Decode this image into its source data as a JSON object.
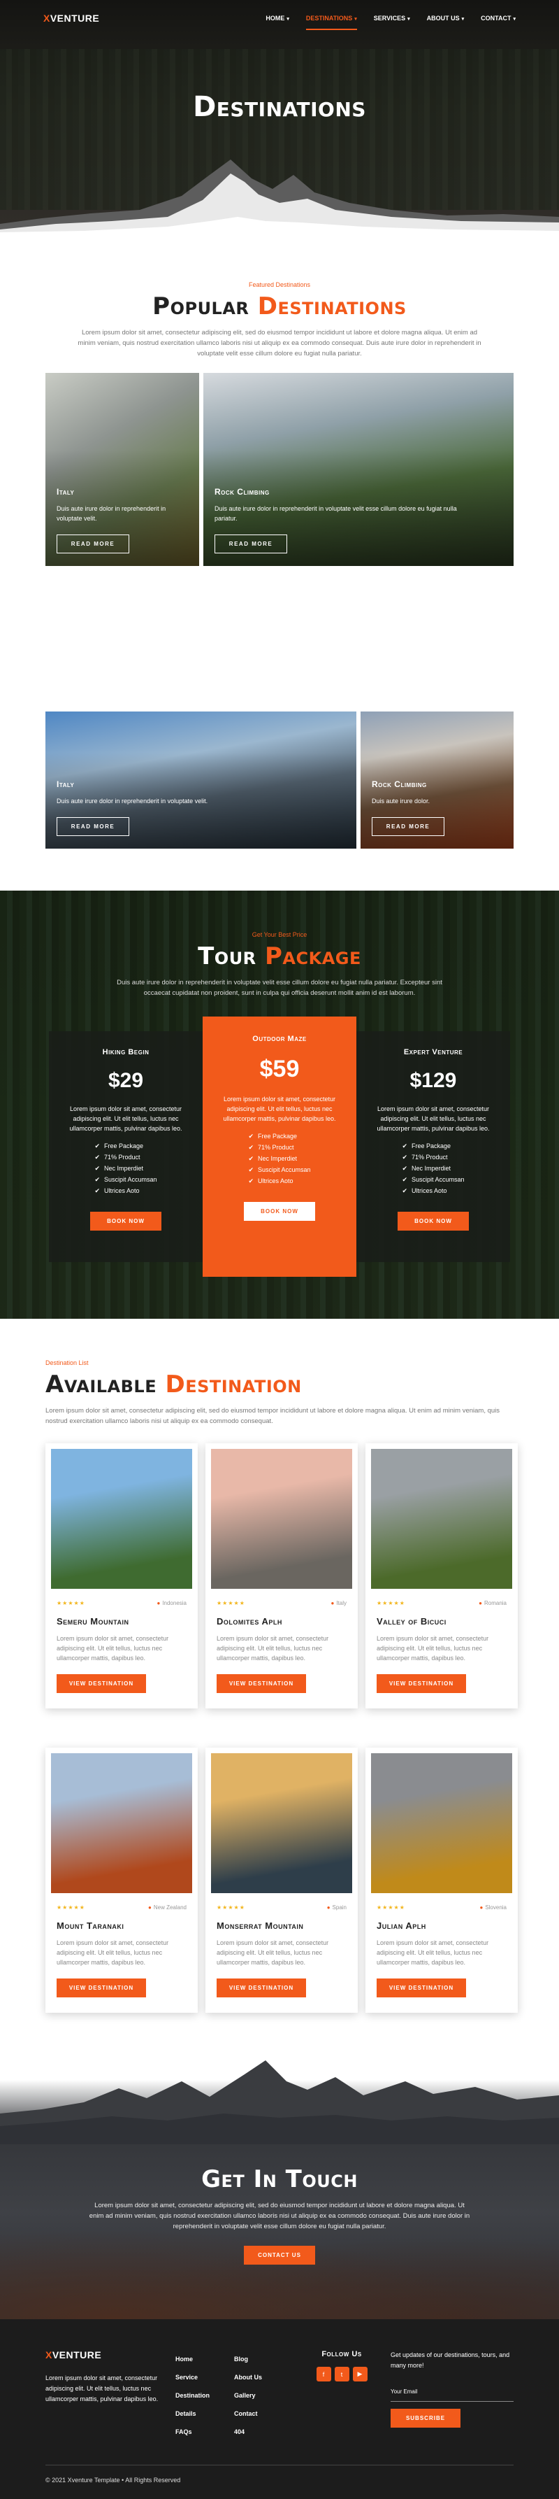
{
  "nav": {
    "logo_x": "X",
    "logo_rest": "VENTURE",
    "items": [
      {
        "label": "Home",
        "caret": "▾",
        "active": false
      },
      {
        "label": "Destinations",
        "caret": "▾",
        "active": true
      },
      {
        "label": "Services",
        "caret": "▾",
        "active": false
      },
      {
        "label": "About Us",
        "caret": "▾",
        "active": false
      },
      {
        "label": "Contact",
        "caret": "▾",
        "active": false
      }
    ]
  },
  "hero": {
    "title": "Destinations"
  },
  "popular": {
    "kicker": "Featured Destinations",
    "title_a": "Popular",
    "title_b": "Destinations",
    "text": "Lorem ipsum dolor sit amet, consectetur adipiscing elit, sed do eiusmod tempor incididunt ut labore et dolore magna aliqua. Ut enim ad minim veniam, quis nostrud exercitation ullamco laboris nisi ut aliquip ex ea commodo consequat. Duis aute irure dolor in reprehenderit in voluptate velit esse cillum dolore eu fugiat nulla pariatur.",
    "tiles": [
      {
        "title": "Italy",
        "text": "Duis aute irure dolor in reprehenderit in voluptate velit.",
        "button": "Read More"
      },
      {
        "title": "Rock Climbing",
        "text": "Duis aute irure dolor in reprehenderit in voluptate velit esse cillum dolore eu fugiat nulla pariatur.",
        "button": "Read More"
      },
      {
        "title": "Italy",
        "text": "Duis aute irure dolor in reprehenderit in voluptate velit.",
        "button": "Read More"
      },
      {
        "title": "Rock Climbing",
        "text": "Duis aute irure dolor.",
        "button": "Read More"
      }
    ]
  },
  "tour": {
    "kicker": "Get Your Best Price",
    "title_a": "Tour",
    "title_b": "Package",
    "text": "Duis aute irure dolor in reprehenderit in voluptate velit esse cillum dolore eu fugiat nulla pariatur. Excepteur sint occaecat cupidatat non proident, sunt in culpa qui officia deserunt mollit anim id est laborum.",
    "plans": [
      {
        "name": "Hiking Begin",
        "price": "$29",
        "desc": "Lorem ipsum dolor sit amet, consectetur adipiscing elit. Ut elit tellus, luctus nec ullamcorper mattis, pulvinar dapibus leo.",
        "features": [
          "Free Package",
          "71% Product",
          "Nec Imperdiet",
          "Suscipit Accumsan",
          "Ultrices Aoto"
        ],
        "button": "Book Now"
      },
      {
        "name": "Outdoor Maze",
        "price": "$59",
        "desc": "Lorem ipsum dolor sit amet, consectetur adipiscing elit. Ut elit tellus, luctus nec ullamcorper mattis, pulvinar dapibus leo.",
        "features": [
          "Free Package",
          "71% Product",
          "Nec Imperdiet",
          "Suscipit Accumsan",
          "Ultrices Aoto"
        ],
        "button": "Book Now"
      },
      {
        "name": "Expert Venture",
        "price": "$129",
        "desc": "Lorem ipsum dolor sit amet, consectetur adipiscing elit. Ut elit tellus, luctus nec ullamcorper mattis, pulvinar dapibus leo.",
        "features": [
          "Free Package",
          "71% Product",
          "Nec Imperdiet",
          "Suscipit Accumsan",
          "Ultrices Aoto"
        ],
        "button": "Book Now"
      }
    ]
  },
  "available": {
    "kicker": "Destination List",
    "title_a": "Available",
    "title_b": "Destination",
    "text": "Lorem ipsum dolor sit amet, consectetur adipiscing elit, sed do eiusmod tempor incididunt ut labore et dolore magna aliqua. Ut enim ad minim veniam, quis nostrud exercitation ullamco laboris nisi ut aliquip ex ea commodo consequat.",
    "cards": [
      {
        "stars": "★★★★★",
        "location": "Indonesia",
        "name": "Semeru Mountain",
        "text": "Lorem ipsum dolor sit amet, consectetur adipiscing elit. Ut elit tellus, luctus nec ullamcorper mattis, dapibus leo.",
        "button": "View Destination",
        "c1": "#7fb4e0",
        "c2": "#3f6b30"
      },
      {
        "stars": "★★★★★",
        "location": "Italy",
        "name": "Dolomites Aplh",
        "text": "Lorem ipsum dolor sit amet, consectetur adipiscing elit. Ut elit tellus, luctus nec ullamcorper mattis, dapibus leo.",
        "button": "View Destination",
        "c1": "#e8b8a8",
        "c2": "#6a6660"
      },
      {
        "stars": "★★★★★",
        "location": "Romania",
        "name": "Valley of Bicuci",
        "text": "Lorem ipsum dolor sit amet, consectetur adipiscing elit. Ut elit tellus, luctus nec ullamcorper mattis, dapibus leo.",
        "button": "View Destination",
        "c1": "#9aa0a4",
        "c2": "#4c6a2a"
      },
      {
        "stars": "★★★★★",
        "location": "New Zealand",
        "name": "Mount Taranaki",
        "text": "Lorem ipsum dolor sit amet, consectetur adipiscing elit. Ut elit tellus, luctus nec ullamcorper mattis, dapibus leo.",
        "button": "View Destination",
        "c1": "#a7bdd6",
        "c2": "#b0481c"
      },
      {
        "stars": "★★★★★",
        "location": "Spain",
        "name": "Monserrat Mountain",
        "text": "Lorem ipsum dolor sit amet, consectetur adipiscing elit. Ut elit tellus, luctus nec ullamcorper mattis, dapibus leo.",
        "button": "View Destination",
        "c1": "#e0b264",
        "c2": "#2e3e4a"
      },
      {
        "stars": "★★★★★",
        "location": "Slovenia",
        "name": "Julian Aplh",
        "text": "Lorem ipsum dolor sit amet, consectetur adipiscing elit. Ut elit tellus, luctus nec ullamcorper mattis, dapibus leo.",
        "button": "View Destination",
        "c1": "#8a8c90",
        "c2": "#c08a1a"
      }
    ]
  },
  "touch": {
    "title": "Get In Touch",
    "text": "Lorem ipsum dolor sit amet, consectetur adipiscing elit, sed do eiusmod tempor incididunt ut labore et dolore magna aliqua. Ut enim ad minim veniam, quis nostrud exercitation ullamco laboris nisi ut aliquip ex ea commodo consequat. Duis aute irure dolor in reprehenderit in voluptate velit esse cillum dolore eu fugiat nulla pariatur.",
    "button": "Contact Us"
  },
  "footer": {
    "about": "Lorem ipsum dolor sit amet, consectetur adipiscing elit. Ut elit tellus, luctus nec ullamcorper mattis, pulvinar dapibus leo.",
    "links1": [
      "Home",
      "Service",
      "Destination",
      "Details",
      "FAQs"
    ],
    "links2": [
      "Blog",
      "About Us",
      "Gallery",
      "Contact",
      "404"
    ],
    "follow": "Follow Us",
    "social": [
      "f",
      "t",
      "▶"
    ],
    "news": "Get updates of our destinations, tours, and many more!",
    "email_placeholder": "Your Email",
    "subscribe": "Subscribe",
    "copyright": "© 2021 Xventure Template • All Rights Reserved"
  },
  "colors": {
    "accent": "#f25a1b",
    "dark": "#1c1c1c"
  }
}
